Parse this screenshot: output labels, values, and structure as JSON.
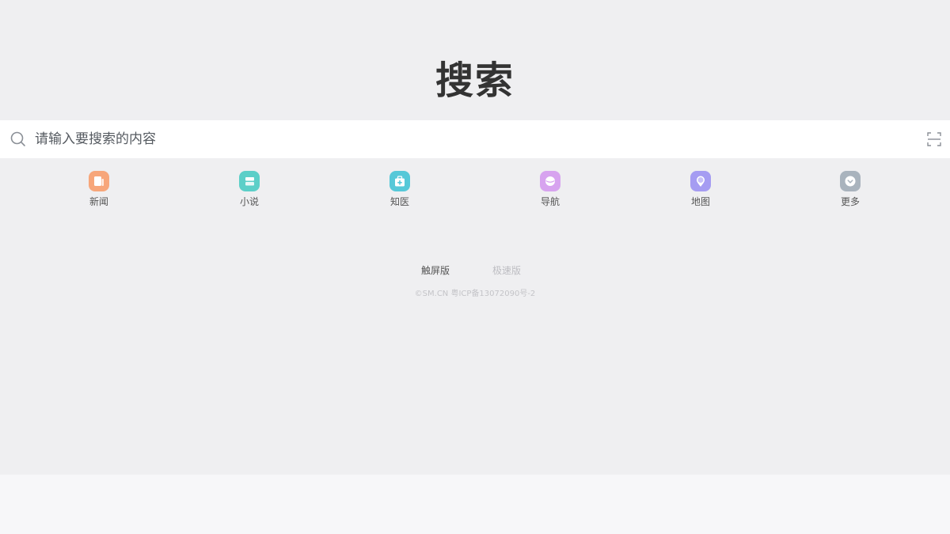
{
  "logo": {
    "text": "搜索"
  },
  "search": {
    "placeholder": "请输入要搜索的内容",
    "value": "",
    "search_icon": "search-icon",
    "scan_icon": "scan-icon"
  },
  "quick_links": [
    {
      "label": "新闻",
      "icon": "news-icon",
      "color": "#f7a67a"
    },
    {
      "label": "小说",
      "icon": "novel-icon",
      "color": "#5ccfc8"
    },
    {
      "label": "知医",
      "icon": "medical-kit-icon",
      "color": "#56c8d8"
    },
    {
      "label": "导航",
      "icon": "navigation-icon",
      "color": "#d7a3ef"
    },
    {
      "label": "地图",
      "icon": "map-pin-icon",
      "color": "#a59cf2"
    },
    {
      "label": "更多",
      "icon": "chevron-down-circle-icon",
      "color": "#a9b3bd"
    }
  ],
  "versions": {
    "touch": "触屏版",
    "speed": "极速版"
  },
  "footer": {
    "copyright": "©SM.CN 粤ICP备13072090号-2"
  }
}
